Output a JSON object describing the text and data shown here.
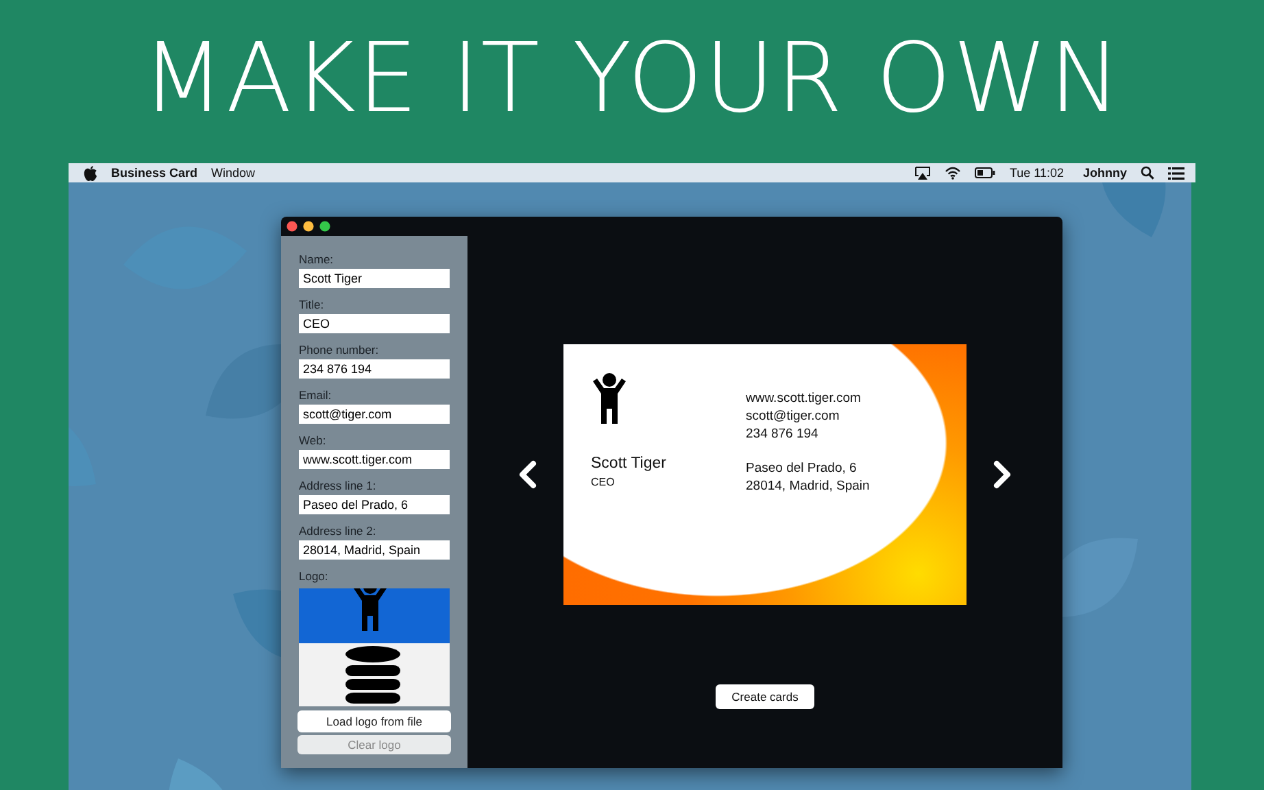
{
  "headline": "MAKE IT YOUR OWN",
  "menu_bar": {
    "app_name": "Business Card",
    "menus": [
      "Window"
    ],
    "clock": "Tue 11:02",
    "user": "Johnny"
  },
  "window": {
    "form": {
      "fields": [
        {
          "label": "Name:",
          "value": "Scott Tiger"
        },
        {
          "label": "Title:",
          "value": "CEO"
        },
        {
          "label": "Phone number:",
          "value": "234 876 194"
        },
        {
          "label": "Email:",
          "value": "scott@tiger.com"
        },
        {
          "label": "Web:",
          "value": "www.scott.tiger.com"
        },
        {
          "label": "Address line 1:",
          "value": "Paseo del Prado, 6"
        },
        {
          "label": "Address line 2:",
          "value": "28014, Madrid, Spain"
        }
      ],
      "logo_label": "Logo:",
      "buttons": [
        {
          "label": "Load logo from file",
          "disabled": false
        },
        {
          "label": "Clear logo",
          "disabled": true
        }
      ]
    },
    "preview": {
      "card": {
        "name": "Scott Tiger",
        "title": "CEO",
        "contact_lines": [
          "www.scott.tiger.com",
          "scott@tiger.com",
          "234 876 194"
        ],
        "address_lines": [
          "Paseo del Prado, 6",
          "28014, Madrid, Spain"
        ]
      },
      "create_button": "Create cards"
    }
  }
}
